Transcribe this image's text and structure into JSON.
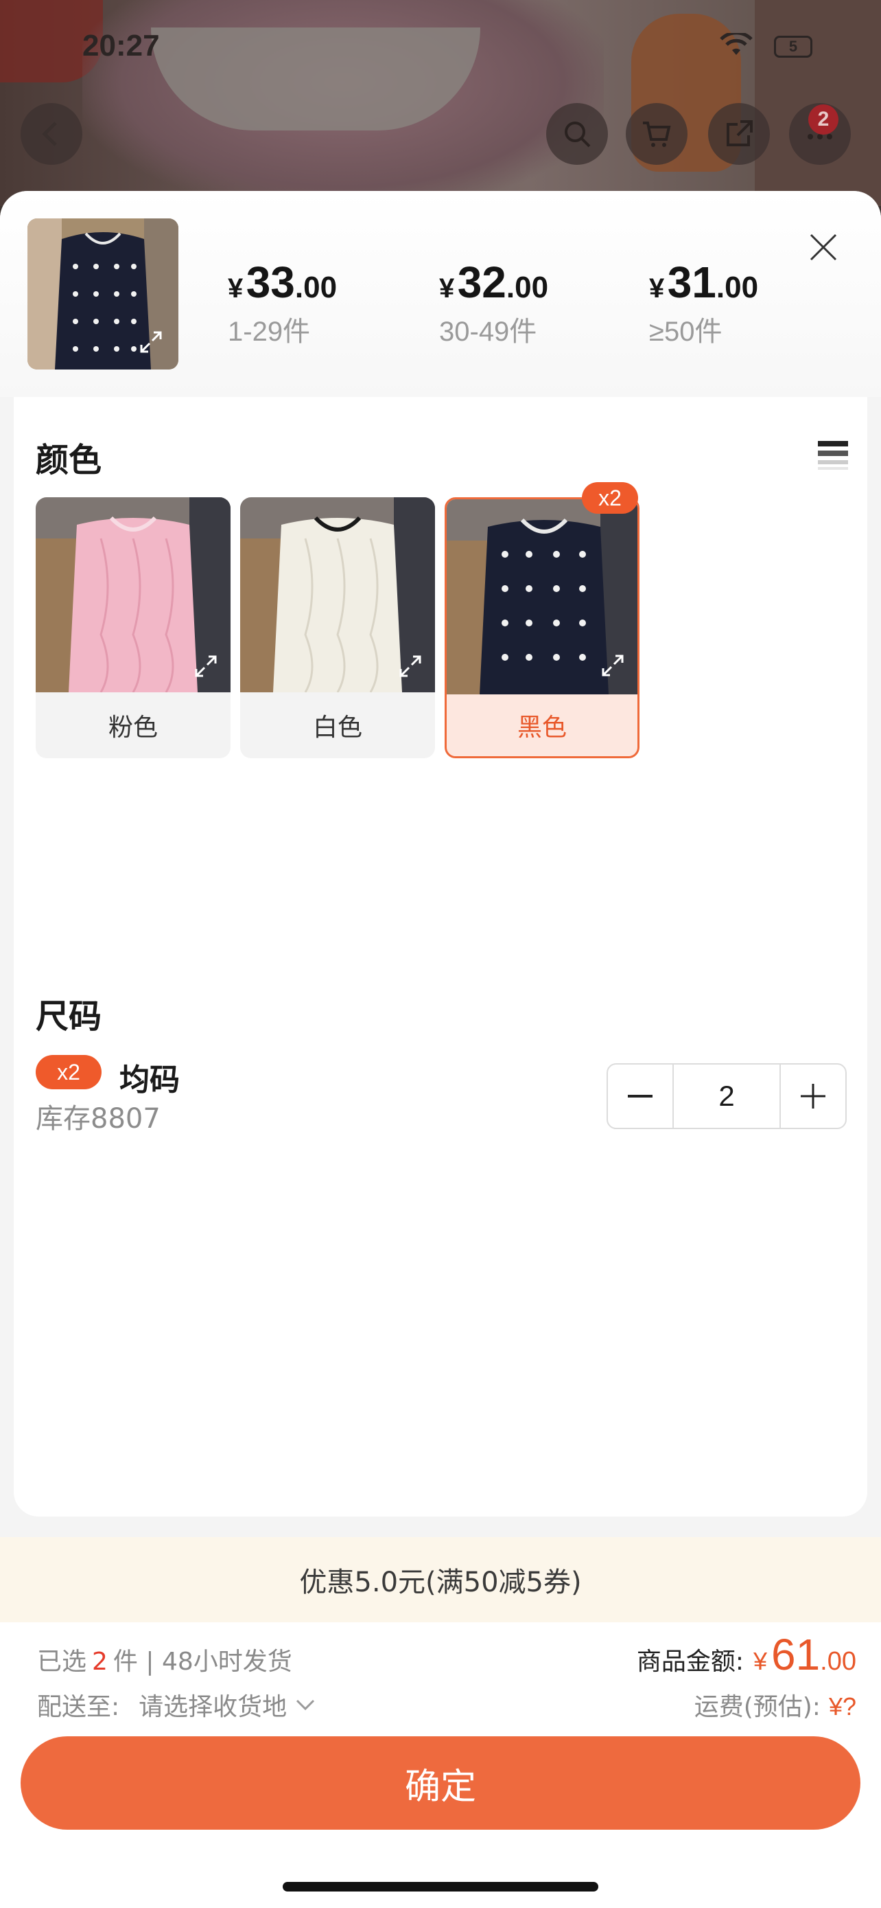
{
  "status_bar": {
    "time": "20:27",
    "battery": "5"
  },
  "top_nav": {
    "cart_badge": "2"
  },
  "sheet": {
    "price_tiers": [
      {
        "currency": "¥",
        "integer": "33",
        "decimal": ".00",
        "range": "1-29件"
      },
      {
        "currency": "¥",
        "integer": "32",
        "decimal": ".00",
        "range": "30-49件"
      },
      {
        "currency": "¥",
        "integer": "31",
        "decimal": ".00",
        "range": "≥50件"
      }
    ],
    "color_section": {
      "title": "颜色",
      "options": [
        {
          "label": "粉色",
          "color": "#f0b6c4"
        },
        {
          "label": "白色",
          "color": "#f2efe6"
        },
        {
          "label": "黑色",
          "color": "#1a1f33"
        }
      ],
      "selected_badge": "x2"
    },
    "size_section": {
      "title": "尺码",
      "badge": "x2",
      "name": "均码",
      "stock": "库存8807",
      "quantity": "2"
    },
    "promo": "优惠5.0元(满50减5券)",
    "summary": {
      "selected_prefix": "已选",
      "selected_count": "2",
      "selected_suffix": "件 | 48小时发货",
      "ship_label": "配送至:",
      "ship_placeholder": "请选择收货地",
      "amount_label": "商品金额:",
      "amount_currency": "¥",
      "amount_integer": "61",
      "amount_decimal": ".00",
      "freight_label": "运费(预估):",
      "freight_value": "¥?"
    },
    "confirm_label": "确定"
  },
  "colors": {
    "accent": "#ee6a3e",
    "badge": "#ef5a2b",
    "promo_bg": "#fcf6ea"
  }
}
